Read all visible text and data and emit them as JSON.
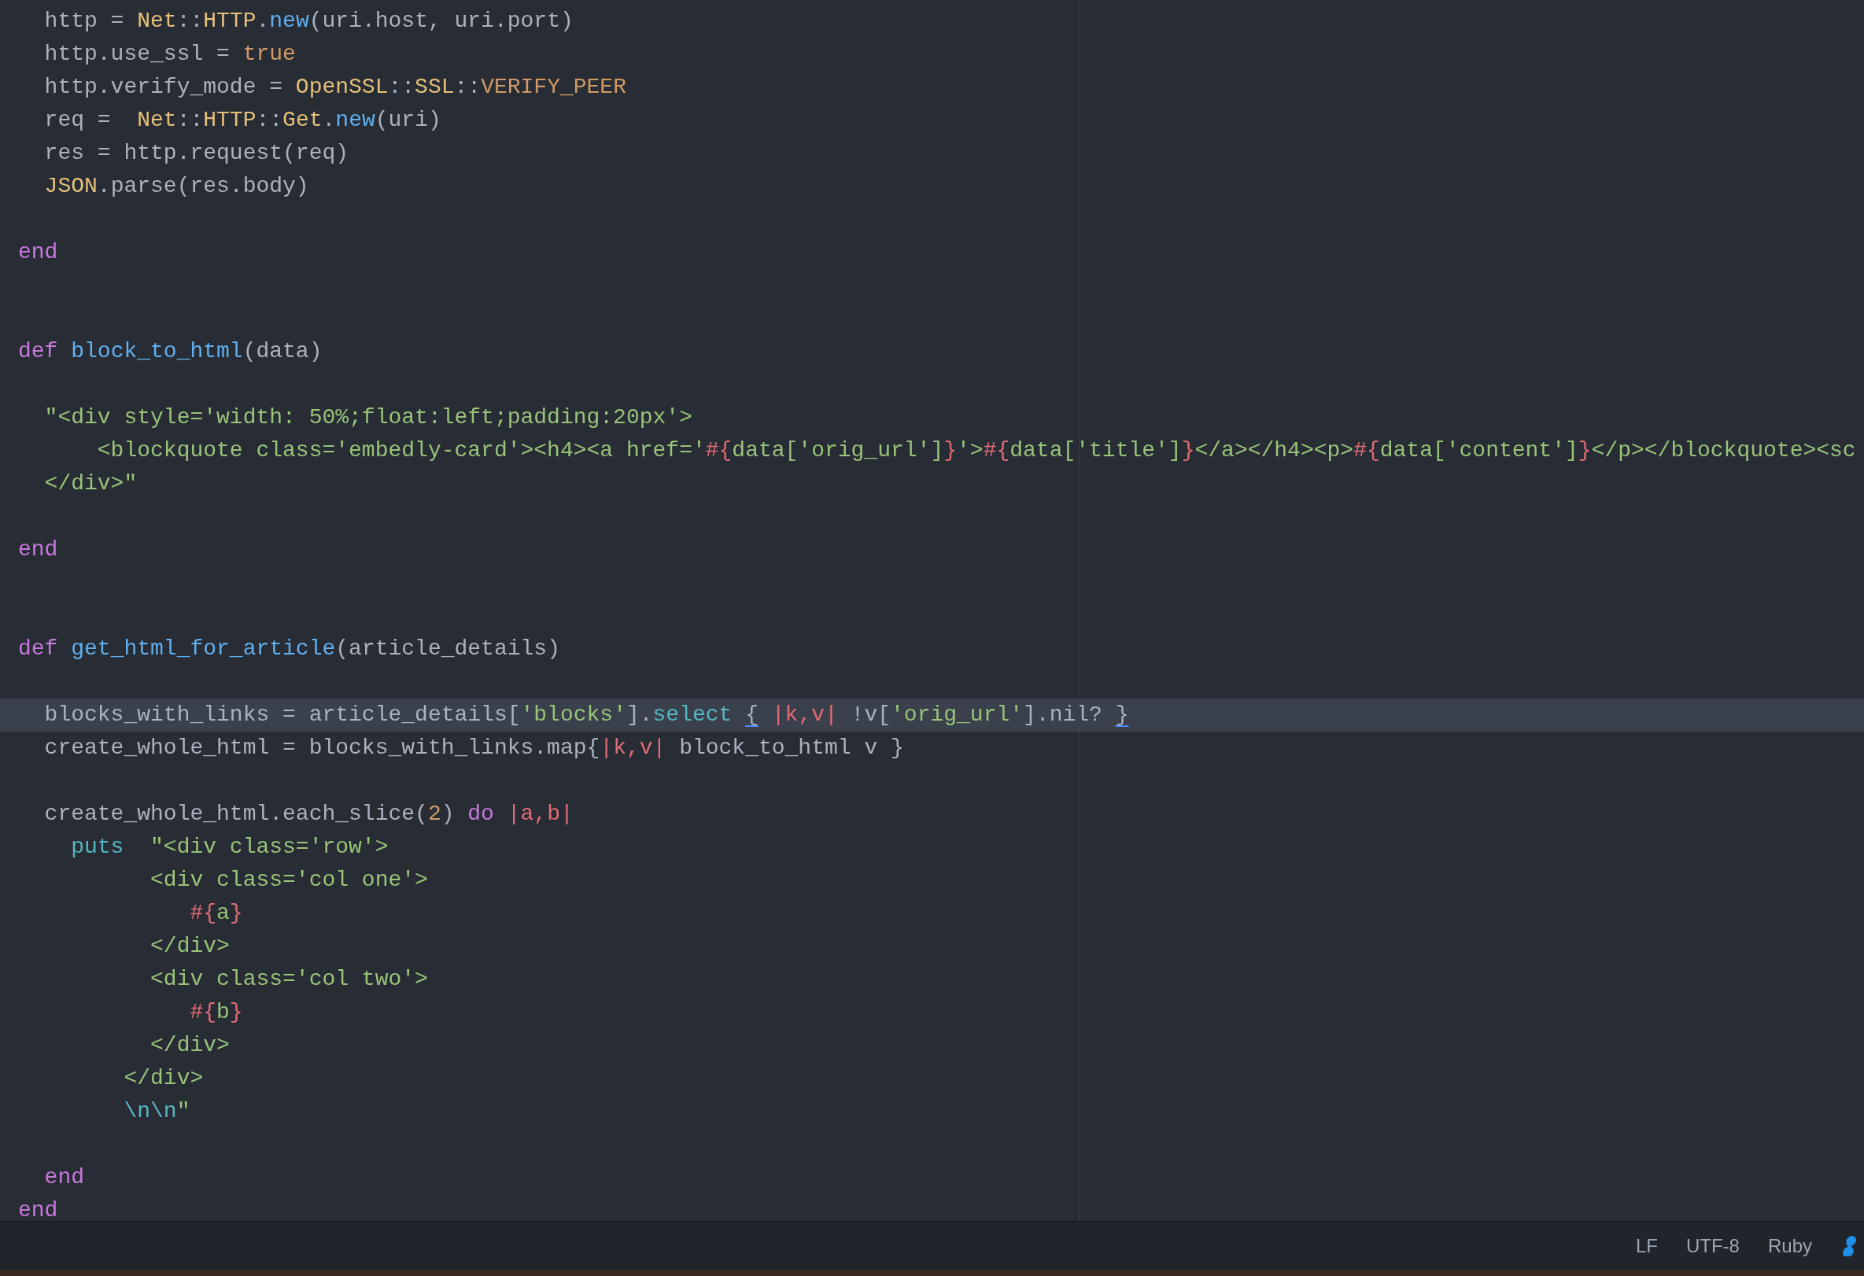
{
  "editor": {
    "lines": [
      {
        "cursor_line": false,
        "tokens": [
          {
            "text": "  http = ",
            "kind": "plain"
          },
          {
            "text": "Net",
            "kind": "class"
          },
          {
            "text": "::",
            "kind": "plain"
          },
          {
            "text": "HTTP",
            "kind": "class"
          },
          {
            "text": ".",
            "kind": "plain"
          },
          {
            "text": "new",
            "kind": "function"
          },
          {
            "text": "(uri.host, uri.port)",
            "kind": "plain"
          }
        ]
      },
      {
        "cursor_line": false,
        "tokens": [
          {
            "text": "  http.use_ssl = ",
            "kind": "plain"
          },
          {
            "text": "true",
            "kind": "constant"
          }
        ]
      },
      {
        "cursor_line": false,
        "tokens": [
          {
            "text": "  http.verify_mode = ",
            "kind": "plain"
          },
          {
            "text": "OpenSSL",
            "kind": "class"
          },
          {
            "text": "::",
            "kind": "plain"
          },
          {
            "text": "SSL",
            "kind": "class"
          },
          {
            "text": "::",
            "kind": "plain"
          },
          {
            "text": "VERIFY_PEER",
            "kind": "constant"
          }
        ]
      },
      {
        "cursor_line": false,
        "tokens": [
          {
            "text": "  req =  ",
            "kind": "plain"
          },
          {
            "text": "Net",
            "kind": "class"
          },
          {
            "text": "::",
            "kind": "plain"
          },
          {
            "text": "HTTP",
            "kind": "class"
          },
          {
            "text": "::",
            "kind": "plain"
          },
          {
            "text": "Get",
            "kind": "class"
          },
          {
            "text": ".",
            "kind": "plain"
          },
          {
            "text": "new",
            "kind": "function"
          },
          {
            "text": "(uri)",
            "kind": "plain"
          }
        ]
      },
      {
        "cursor_line": false,
        "tokens": [
          {
            "text": "  res = http.request(req)",
            "kind": "plain"
          }
        ]
      },
      {
        "cursor_line": false,
        "tokens": [
          {
            "text": "  JSON",
            "kind": "class"
          },
          {
            "text": ".parse(res.body)",
            "kind": "plain"
          }
        ]
      },
      {
        "cursor_line": false
      },
      {
        "cursor_line": false,
        "tokens": [
          {
            "text": "end",
            "kind": "keyword"
          }
        ]
      },
      {
        "cursor_line": false
      },
      {
        "cursor_line": false
      },
      {
        "cursor_line": false,
        "tokens": [
          {
            "text": "def ",
            "kind": "keyword"
          },
          {
            "text": "block_to_html",
            "kind": "function"
          },
          {
            "text": "(data)",
            "kind": "plain"
          }
        ]
      },
      {
        "cursor_line": false
      },
      {
        "cursor_line": false,
        "tokens": [
          {
            "text": "  \"<div style='width: 50%;float:left;padding:20px'>",
            "kind": "string"
          }
        ]
      },
      {
        "cursor_line": false,
        "tokens": [
          {
            "text": "      <blockquote class='embedly-card'><h4><a href='",
            "kind": "string"
          },
          {
            "text": "#{",
            "kind": "interp"
          },
          {
            "text": "data['orig_url']",
            "kind": "string"
          },
          {
            "text": "}",
            "kind": "interp"
          },
          {
            "text": "'>",
            "kind": "string"
          },
          {
            "text": "#{",
            "kind": "interp"
          },
          {
            "text": "data['title']",
            "kind": "string"
          },
          {
            "text": "}",
            "kind": "interp"
          },
          {
            "text": "</a></h4><p>",
            "kind": "string"
          },
          {
            "text": "#{",
            "kind": "interp"
          },
          {
            "text": "data['content']",
            "kind": "string"
          },
          {
            "text": "}",
            "kind": "interp"
          },
          {
            "text": "</p></blockquote><sc",
            "kind": "string"
          }
        ]
      },
      {
        "cursor_line": false,
        "tokens": [
          {
            "text": "  </div>\"",
            "kind": "string"
          }
        ]
      },
      {
        "cursor_line": false
      },
      {
        "cursor_line": false,
        "tokens": [
          {
            "text": "end",
            "kind": "keyword"
          }
        ]
      },
      {
        "cursor_line": false
      },
      {
        "cursor_line": false
      },
      {
        "cursor_line": false,
        "tokens": [
          {
            "text": "def ",
            "kind": "keyword"
          },
          {
            "text": "get_html_for_article",
            "kind": "function"
          },
          {
            "text": "(article_details)",
            "kind": "plain"
          }
        ]
      },
      {
        "cursor_line": false
      },
      {
        "cursor_line": true,
        "tokens": [
          {
            "text": "  blocks_with_links = article_details[",
            "kind": "plain"
          },
          {
            "text": "'blocks'",
            "kind": "string"
          },
          {
            "text": "].",
            "kind": "plain"
          },
          {
            "text": "select ",
            "kind": "method"
          },
          {
            "text": "{",
            "kind": "bracket_match"
          },
          {
            "text": " |k,v|",
            "kind": "param"
          },
          {
            "text": " !v[",
            "kind": "plain"
          },
          {
            "text": "'orig_url'",
            "kind": "string"
          },
          {
            "text": "].nil? ",
            "kind": "plain"
          },
          {
            "text": "}",
            "kind": "bracket_match"
          }
        ]
      },
      {
        "cursor_line": false,
        "tokens": [
          {
            "text": "  create_whole_html = blocks_with_links.map{",
            "kind": "plain"
          },
          {
            "text": "|k,v|",
            "kind": "param"
          },
          {
            "text": " block_to_html v }",
            "kind": "plain"
          }
        ]
      },
      {
        "cursor_line": false
      },
      {
        "cursor_line": false,
        "tokens": [
          {
            "text": "  create_whole_html.each_slice(",
            "kind": "plain"
          },
          {
            "text": "2",
            "kind": "constant"
          },
          {
            "text": ") ",
            "kind": "plain"
          },
          {
            "text": "do ",
            "kind": "keyword"
          },
          {
            "text": "|a,b|",
            "kind": "param"
          }
        ]
      },
      {
        "cursor_line": false,
        "tokens": [
          {
            "text": "    puts",
            "kind": "method"
          },
          {
            "text": "  \"<div class='row'>",
            "kind": "string"
          }
        ]
      },
      {
        "cursor_line": false,
        "tokens": [
          {
            "text": "          <div class='col one'>",
            "kind": "string"
          }
        ]
      },
      {
        "cursor_line": false,
        "tokens": [
          {
            "text": "             #{",
            "kind": "interp"
          },
          {
            "text": "a",
            "kind": "string"
          },
          {
            "text": "}",
            "kind": "interp"
          }
        ]
      },
      {
        "cursor_line": false,
        "tokens": [
          {
            "text": "          </div>",
            "kind": "string"
          }
        ]
      },
      {
        "cursor_line": false,
        "tokens": [
          {
            "text": "          <div class='col two'>",
            "kind": "string"
          }
        ]
      },
      {
        "cursor_line": false,
        "tokens": [
          {
            "text": "             #{",
            "kind": "interp"
          },
          {
            "text": "b",
            "kind": "string"
          },
          {
            "text": "}",
            "kind": "interp"
          }
        ]
      },
      {
        "cursor_line": false,
        "tokens": [
          {
            "text": "          </div>",
            "kind": "string"
          }
        ]
      },
      {
        "cursor_line": false,
        "tokens": [
          {
            "text": "        </div>",
            "kind": "string"
          }
        ]
      },
      {
        "cursor_line": false,
        "tokens": [
          {
            "text": "        \\n\\n",
            "kind": "method"
          },
          {
            "text": "\"",
            "kind": "string"
          }
        ]
      },
      {
        "cursor_line": false
      },
      {
        "cursor_line": false,
        "tokens": [
          {
            "text": "  end",
            "kind": "keyword"
          }
        ]
      },
      {
        "cursor_line": false,
        "tokens": [
          {
            "text": "end",
            "kind": "keyword"
          }
        ]
      }
    ]
  },
  "status_bar": {
    "line_ending": "LF",
    "encoding": "UTF-8",
    "grammar": "Ruby"
  }
}
